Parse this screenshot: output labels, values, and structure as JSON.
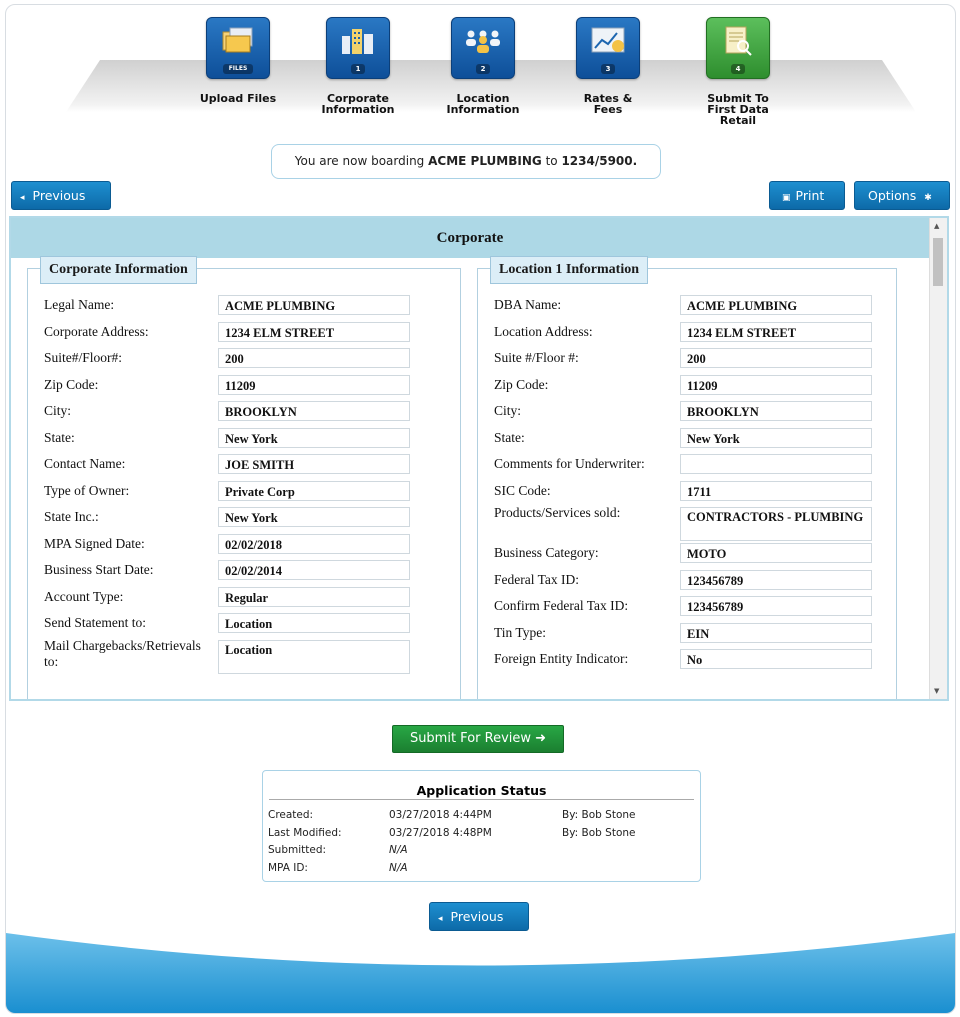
{
  "steps": [
    {
      "label_line1": "Upload Files",
      "label_line2": "",
      "badge": "FILES",
      "icon": "files-icon"
    },
    {
      "label_line1": "Corporate",
      "label_line2": "Information",
      "badge": "1",
      "icon": "buildings-icon"
    },
    {
      "label_line1": "Location",
      "label_line2": "Information",
      "badge": "2",
      "icon": "people-icon"
    },
    {
      "label_line1": "Rates &",
      "label_line2": "Fees",
      "badge": "3",
      "icon": "rates-chart-icon"
    },
    {
      "label_line1": "Submit To",
      "label_line2": "First Data Retail",
      "badge": "4",
      "icon": "document-search-icon"
    }
  ],
  "notice": {
    "prefix": "You are now boarding",
    "merchant": "ACME PLUMBING",
    "mid_text": "to",
    "account": "1234/5900."
  },
  "buttons": {
    "previous": "Previous",
    "print": "Print",
    "options": "Options",
    "submit": "Submit For Review",
    "previous_bottom": "Previous"
  },
  "panel": {
    "title": "Corporate"
  },
  "corporate": {
    "legend": "Corporate Information",
    "rows": [
      {
        "label": "Legal Name:",
        "value": "ACME PLUMBING"
      },
      {
        "label": "Corporate Address:",
        "value": "1234 ELM STREET"
      },
      {
        "label": "Suite#/Floor#:",
        "value": "200"
      },
      {
        "label": "Zip Code:",
        "value": "11209"
      },
      {
        "label": "City:",
        "value": "BROOKLYN"
      },
      {
        "label": "State:",
        "value": "New York"
      },
      {
        "label": "Contact Name:",
        "value": "JOE SMITH"
      },
      {
        "label": "Type of Owner:",
        "value": "Private Corp"
      },
      {
        "label": "State Inc.:",
        "value": "New York"
      },
      {
        "label": "MPA Signed Date:",
        "value": "02/02/2018"
      },
      {
        "label": "Business Start Date:",
        "value": "02/02/2014"
      },
      {
        "label": "Account Type:",
        "value": "Regular"
      },
      {
        "label": "Send Statement to:",
        "value": "Location"
      },
      {
        "label": "Mail Chargebacks/Retrievals to:",
        "value": "Location"
      }
    ]
  },
  "location": {
    "legend": "Location 1 Information",
    "rows": [
      {
        "label": "DBA Name:",
        "value": "ACME PLUMBING"
      },
      {
        "label": "Location Address:",
        "value": "1234 ELM STREET"
      },
      {
        "label": "Suite #/Floor #:",
        "value": "200"
      },
      {
        "label": "Zip Code:",
        "value": "11209"
      },
      {
        "label": "City:",
        "value": "BROOKLYN"
      },
      {
        "label": "State:",
        "value": "New York"
      },
      {
        "label": "Comments for Underwriter:",
        "value": ""
      },
      {
        "label": "SIC Code:",
        "value": "1711"
      },
      {
        "label": "Products/Services sold:",
        "value": "CONTRACTORS - PLUMBING"
      },
      {
        "label": "Business Category:",
        "value": "MOTO"
      },
      {
        "label": "Federal Tax ID:",
        "value": "123456789"
      },
      {
        "label": "Confirm Federal Tax ID:",
        "value": "123456789"
      },
      {
        "label": "Tin Type:",
        "value": "EIN"
      },
      {
        "label": "Foreign Entity Indicator:",
        "value": "No"
      }
    ]
  },
  "status": {
    "title": "Application Status",
    "rows": [
      {
        "label": "Created:",
        "date": "03/27/2018 4:44PM",
        "by": "By: Bob Stone"
      },
      {
        "label": "Last Modified:",
        "date": "03/27/2018 4:48PM",
        "by": "By: Bob Stone"
      },
      {
        "label": "Submitted:",
        "date": "N/A",
        "by": ""
      },
      {
        "label": "MPA ID:",
        "date": "N/A",
        "by": ""
      }
    ]
  },
  "colors": {
    "accent": "#0d6aa8",
    "panel_header": "#add8e6",
    "submit": "#1b7f30"
  }
}
